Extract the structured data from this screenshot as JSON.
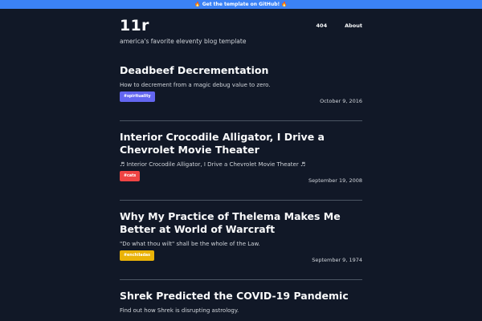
{
  "banner": {
    "icon": "fire-icon",
    "text": "Get the template on GitHub!",
    "color": "#3b82f6"
  },
  "site": {
    "title": "11r",
    "tagline": "america's favorite eleventy blog template"
  },
  "nav": [
    {
      "label": "404"
    },
    {
      "label": "About"
    }
  ],
  "posts": [
    {
      "title": "Deadbeef Decrementation",
      "excerpt": "How to decrement from a magic debug value to zero.",
      "tag": "#spirituality",
      "tag_color": "#6366f1",
      "date": "October 9, 2016"
    },
    {
      "title": "Interior Crocodile Alligator, I Drive a Chevrolet Movie Theater",
      "excerpt": "♬ Interior Crocodile Alligator, I Drive a Chevrolet Movie Theater ♬",
      "tag": "#cats",
      "tag_color": "#ef4444",
      "date": "September 19, 2008"
    },
    {
      "title": "Why My Practice of Thelema Makes Me Better at World of Warcraft",
      "excerpt": "\"Do what thou wilt\" shall be the whole of the Law.",
      "tag": "#enchiladas",
      "tag_color": "#eab308",
      "date": "September 9, 1974"
    },
    {
      "title": "Shrek Predicted the COVID-19 Pandemic",
      "excerpt": "Find out how Shrek is disrupting astrology."
    }
  ],
  "colors": {
    "background": "#111827",
    "divider": "#4b5563",
    "text": "#f3f4f6",
    "muted": "#d1d5db"
  }
}
